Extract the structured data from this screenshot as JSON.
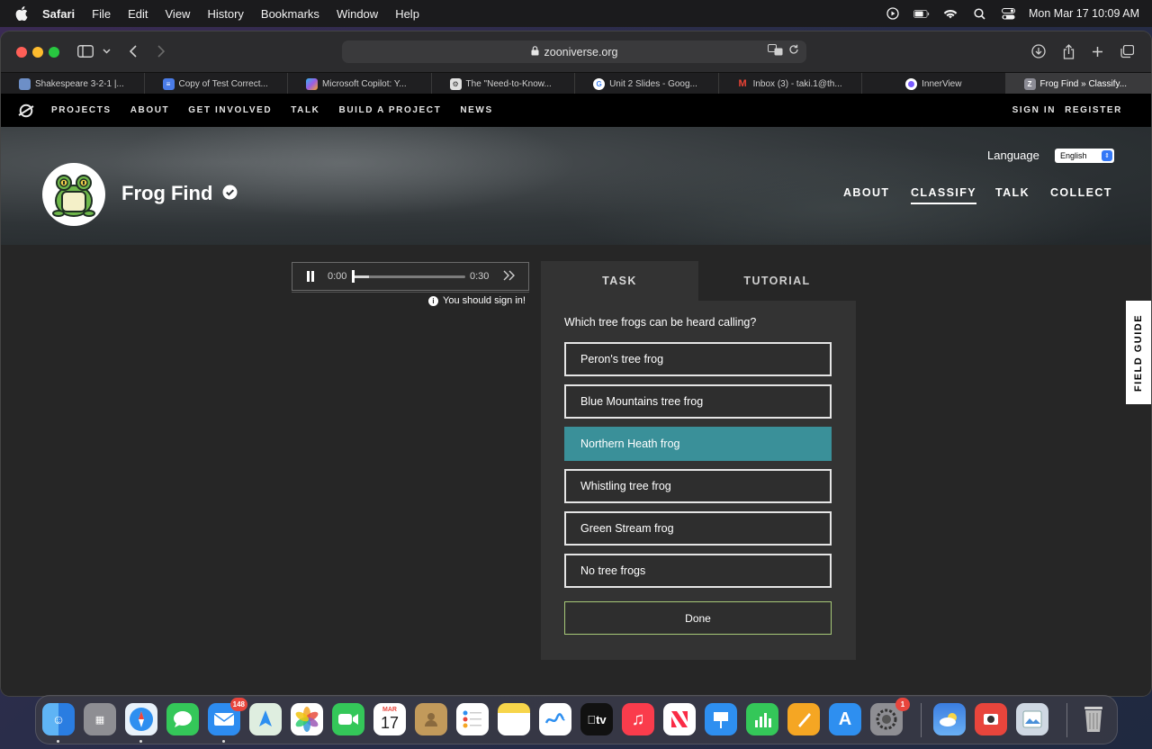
{
  "menubar": {
    "app": "Safari",
    "items": [
      "File",
      "Edit",
      "View",
      "History",
      "Bookmarks",
      "Window",
      "Help"
    ],
    "clock": "Mon Mar 17  10:09 AM"
  },
  "browser": {
    "url": "zooniverse.org",
    "tabs": [
      {
        "label": "Shakespeare 3-2-1 |...",
        "icon": "doc-icon",
        "color": "#6d8fc7"
      },
      {
        "label": "Copy of Test Correct...",
        "icon": "google-docs-icon",
        "color": "#4a7ce8"
      },
      {
        "label": "Microsoft Copilot: Y...",
        "icon": "copilot-icon",
        "color": "#9b5de5"
      },
      {
        "label": "The \"Need-to-Know...",
        "icon": "site-icon",
        "color": "#e0e0e0"
      },
      {
        "label": "Unit 2 Slides - Goog...",
        "icon": "google-icon",
        "color": "#ffffff"
      },
      {
        "label": "Inbox (3) - taki.1@th...",
        "icon": "gmail-icon",
        "color": "#ea4335"
      },
      {
        "label": "InnerView",
        "icon": "innerview-icon",
        "color": "#7a5cff"
      },
      {
        "label": "Frog Find » Classify...",
        "icon": "zooniverse-icon",
        "color": "#8c8c95"
      }
    ]
  },
  "zooniverse_nav": {
    "links": [
      "PROJECTS",
      "ABOUT",
      "GET INVOLVED",
      "TALK",
      "BUILD A PROJECT",
      "NEWS"
    ],
    "sign_in": "SIGN IN",
    "register": "REGISTER"
  },
  "project": {
    "title": "Frog Find",
    "language_label": "Language",
    "language_value": "English",
    "nav": [
      "ABOUT",
      "CLASSIFY",
      "TALK",
      "COLLECT"
    ],
    "active_nav": "CLASSIFY"
  },
  "player": {
    "current_time": "0:00",
    "duration": "0:30",
    "sign_in_note": "You should sign in!"
  },
  "task": {
    "tabs": [
      "TASK",
      "TUTORIAL"
    ],
    "question": "Which tree frogs can be heard calling?",
    "answers": [
      {
        "label": "Peron's tree frog",
        "selected": false
      },
      {
        "label": "Blue Mountains tree frog",
        "selected": false
      },
      {
        "label": "Northern Heath frog",
        "selected": true
      },
      {
        "label": "Whistling tree frog",
        "selected": false
      },
      {
        "label": "Green Stream frog",
        "selected": false
      },
      {
        "label": "No tree frogs",
        "selected": false
      }
    ],
    "done": "Done"
  },
  "field_guide": "FIELD GUIDE",
  "dock": {
    "mail_badge": "148",
    "calendar_month": "MAR",
    "calendar_day": "17",
    "settings_badge": "1",
    "tv_label": "tv"
  },
  "colors": {
    "selected_answer": "#3a9099",
    "done_border": "#a7c978"
  }
}
